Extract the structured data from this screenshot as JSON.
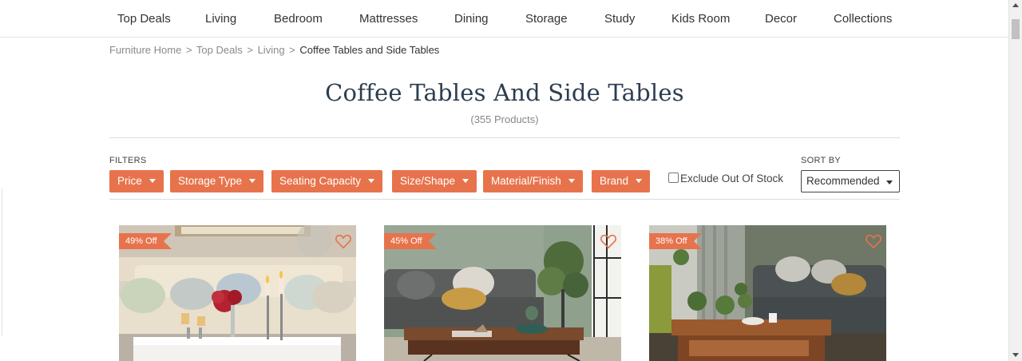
{
  "nav": {
    "items": [
      {
        "label": "Top Deals"
      },
      {
        "label": "Living"
      },
      {
        "label": "Bedroom"
      },
      {
        "label": "Mattresses"
      },
      {
        "label": "Dining"
      },
      {
        "label": "Storage"
      },
      {
        "label": "Study"
      },
      {
        "label": "Kids Room"
      },
      {
        "label": "Decor"
      },
      {
        "label": "Collections"
      }
    ]
  },
  "breadcrumb": {
    "items": [
      "Furniture Home",
      "Top Deals",
      "Living"
    ],
    "separator": ">",
    "current": "Coffee Tables and Side Tables"
  },
  "page": {
    "title": "Coffee Tables And Side Tables",
    "count": "(355 Products)"
  },
  "filters": {
    "label": "FILTERS",
    "buttons": [
      {
        "label": "Price"
      },
      {
        "label": "Storage Type"
      },
      {
        "label": "Seating Capacity"
      },
      {
        "label": "Size/Shape"
      },
      {
        "label": "Material/Finish"
      },
      {
        "label": "Brand"
      }
    ],
    "exclude_out_of_stock": {
      "label": "Exclude Out Of Stock",
      "checked": false
    }
  },
  "sort": {
    "label": "SORT BY",
    "selected": "Recommended"
  },
  "products": [
    {
      "discount": "49% Off",
      "icon": "heart-outline-icon"
    },
    {
      "discount": "45% Off",
      "icon": "heart-outline-icon"
    },
    {
      "discount": "38% Off",
      "icon": "heart-outline-icon"
    }
  ],
  "colors": {
    "accent": "#e7734c",
    "title": "#2c3e50"
  }
}
